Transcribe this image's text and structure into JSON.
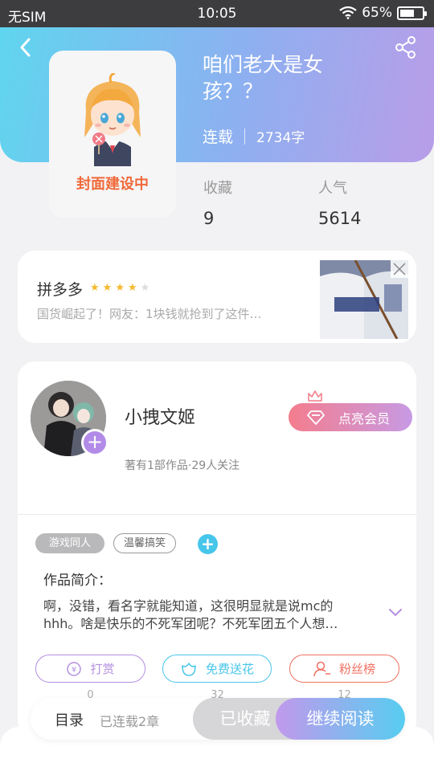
{
  "status_bar": {
    "carrier": "无SIM",
    "time": "10:05",
    "battery": "65%",
    "battery_level": 0.65
  },
  "book": {
    "title": "咱们老大是女孩？？",
    "status": "连载",
    "word_count": "2734字",
    "cover_text": "封面建设中",
    "stats": [
      {
        "label": "收藏",
        "value": "9"
      },
      {
        "label": "人气",
        "value": "5614"
      }
    ]
  },
  "ad": {
    "name": "拼多多",
    "rating": 4,
    "rating_max": 5,
    "description": "国货崛起了！网友：1块钱就抢到了这件…"
  },
  "author": {
    "name": "小拽文姬",
    "summary": "著有1部作品·29人关注",
    "vip_label": "点亮会员"
  },
  "tags": [
    "游戏同人",
    "温馨搞笑"
  ],
  "intro": {
    "title": "作品简介：",
    "line1": "啊，没错，看名字就能知道，这很明显就是说mc的",
    "line2": "hhh。啥是快乐的不死军团呢？不死军团五个人想…"
  },
  "actions": {
    "tip": "打赏",
    "flower": "免费送花",
    "fans": "粉丝榜",
    "tip_count": "0",
    "flower_count": "32",
    "fans_count": "12"
  },
  "bottom": {
    "toc": "目录",
    "chapters": "已连载2章",
    "collected": "已收藏",
    "read": "继续阅读"
  },
  "colors": {
    "header_gradient": [
      "#5fd6ef",
      "#b99de8"
    ],
    "accent_purple": "#b48fe0",
    "accent_cyan": "#47c6ea",
    "accent_red": "#f07060",
    "star": "#f5b92d"
  }
}
